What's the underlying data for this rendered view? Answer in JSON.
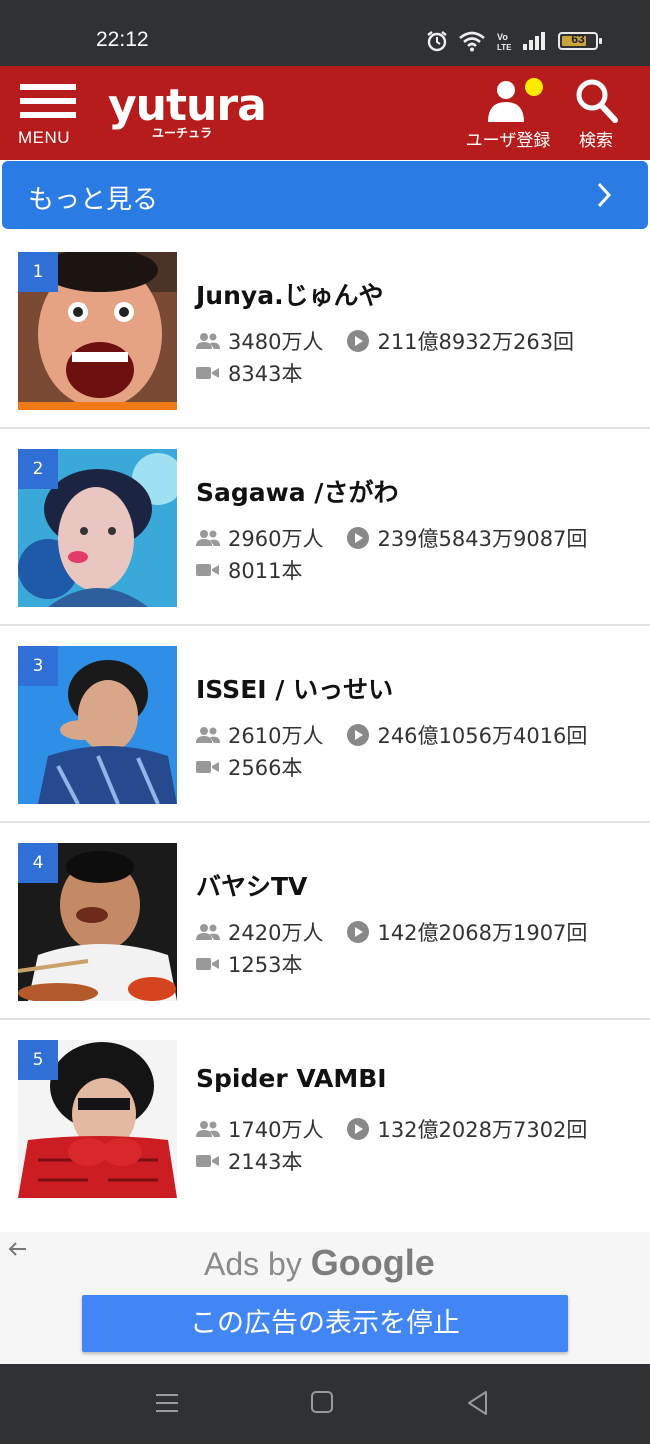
{
  "status_bar": {
    "time": "22:12",
    "network_label": "Vo LTE",
    "battery": "63"
  },
  "header": {
    "menu_label": "MENU",
    "logo_text": "yutura",
    "logo_sub": "ユーチュラ",
    "register_label": "ユーザ登録",
    "search_label": "検索",
    "colors": {
      "header_bg": "#b71c1c",
      "notification_dot": "#ffeb00"
    }
  },
  "more_bar": {
    "label": "もっと見る",
    "color": "#2a7be4"
  },
  "channels": [
    {
      "rank": "1",
      "name": "Junya.じゅんや",
      "subscribers": "3480万人",
      "views": "211億8932万263回",
      "videos": "8343本"
    },
    {
      "rank": "2",
      "name": "Sagawa /さがわ",
      "subscribers": "2960万人",
      "views": "239億5843万9087回",
      "videos": "8011本"
    },
    {
      "rank": "3",
      "name": "ISSEI / いっせい",
      "subscribers": "2610万人",
      "views": "246億1056万4016回",
      "videos": "2566本"
    },
    {
      "rank": "4",
      "name": "バヤシTV",
      "subscribers": "2420万人",
      "views": "142億2068万1907回",
      "videos": "1253本"
    },
    {
      "rank": "5",
      "name": "Spider VAMBI",
      "subscribers": "1740万人",
      "views": "132億2028万7302回",
      "videos": "2143本"
    }
  ],
  "ad": {
    "ads_by": "Ads by",
    "google": "Google",
    "stop_button": "この広告の表示を停止",
    "button_color": "#4285f4"
  },
  "icons": {
    "menu": "hamburger-icon",
    "user": "user-icon",
    "search": "search-icon",
    "chevron": "chevron-right-icon",
    "subscribers": "people-icon",
    "views": "play-circle-icon",
    "videos": "video-camera-icon",
    "back": "back-arrow-icon",
    "nav": [
      "recents-icon",
      "home-icon",
      "back-icon"
    ]
  }
}
